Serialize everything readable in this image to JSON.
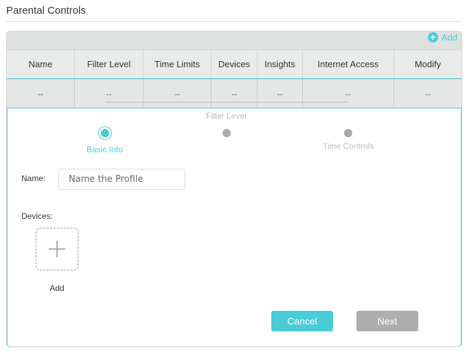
{
  "page": {
    "title": "Parental Controls"
  },
  "toolbar": {
    "add_label": "Add",
    "add_icon": "plus-circle-icon"
  },
  "table": {
    "headers": [
      "Name",
      "Filter Level",
      "Time Limits",
      "Devices",
      "Insights",
      "Internet Access",
      "Modify"
    ],
    "row": [
      "--",
      "--",
      "--",
      "--",
      "--",
      "--",
      "--"
    ]
  },
  "steps": [
    {
      "label": "Basic Info",
      "active": true
    },
    {
      "label": "Filter Level",
      "active": false
    },
    {
      "label": "Time Controls",
      "active": false
    }
  ],
  "form": {
    "name_label": "Name:",
    "name_placeholder": "Name the Profile",
    "name_value": "",
    "devices_label": "Devices:",
    "add_device_label": "Add"
  },
  "buttons": {
    "cancel": "Cancel",
    "next": "Next"
  },
  "colors": {
    "accent": "#4acbd6",
    "disabled": "#aeaeae"
  }
}
